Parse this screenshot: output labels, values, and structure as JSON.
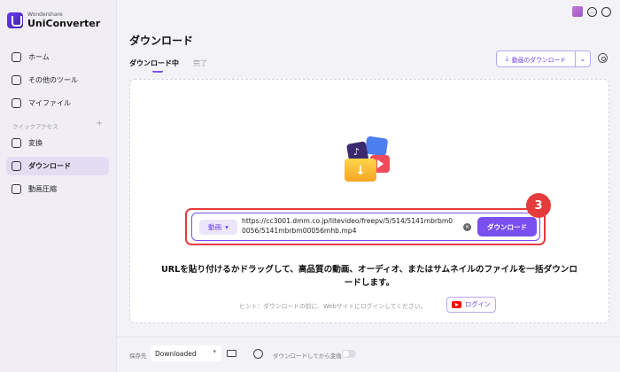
{
  "brand": {
    "company": "Wondershare",
    "product": "UniConverter"
  },
  "sidebar": {
    "items": [
      {
        "label": "ホーム",
        "icon": "home-icon"
      },
      {
        "label": "その他のツール",
        "icon": "toolbox-icon"
      },
      {
        "label": "マイファイル",
        "icon": "file-icon"
      }
    ],
    "quick_access_label": "クイックアクセス",
    "quick_items": [
      {
        "label": "変換",
        "icon": "convert-icon"
      },
      {
        "label": "ダウンロード",
        "icon": "download-icon",
        "active": true
      },
      {
        "label": "動画圧縮",
        "icon": "compress-icon"
      }
    ]
  },
  "header": {
    "title": "ダウンロード",
    "tabs": [
      {
        "label": "ダウンロード中",
        "active": true
      },
      {
        "label": "完了",
        "active": false
      }
    ],
    "download_video_button": "動画のダウンロード"
  },
  "download_panel": {
    "type_select": "動画",
    "url_value": "https://cc3001.dmm.co.jp/litevideo/freepv/5/514/5141mbrbm00056/5141mbrbm00056mhb.mp4",
    "download_button": "ダウンロード",
    "step_number": "3",
    "instruction": "URLを貼り付けるかドラッグして、高品質の動画、オーディオ、またはサムネイルのファイルを一括ダウンロードします。",
    "hint": "ヒント：ダウンロードの前に、Webサイトにログインしてください。",
    "login_button": "ログイン"
  },
  "footer": {
    "save_label": "保存先",
    "save_location": "Downloaded",
    "convert_after_label": "ダウンロードしてから変換"
  },
  "colors": {
    "accent": "#7a4ff0",
    "highlight": "#e63b3b"
  }
}
